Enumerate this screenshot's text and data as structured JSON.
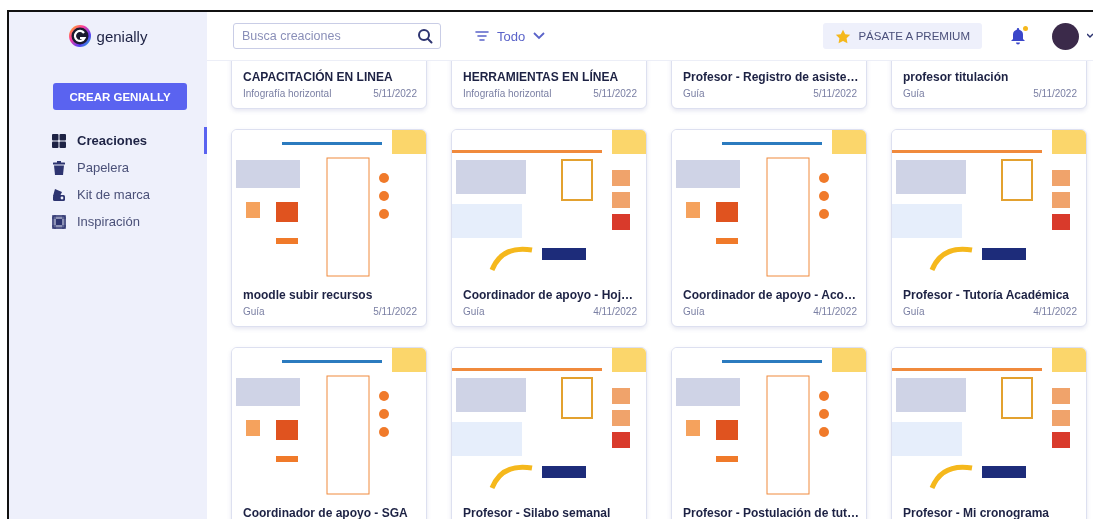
{
  "brand": {
    "name": "genially"
  },
  "create_button": "CREAR GENIALLY",
  "sidebar": {
    "items": [
      {
        "label": "Creaciones",
        "selected": true
      },
      {
        "label": "Papelera",
        "selected": false
      },
      {
        "label": "Kit de marca",
        "selected": false
      },
      {
        "label": "Inspiración",
        "selected": false
      }
    ]
  },
  "header": {
    "search": {
      "placeholder": "Busca creaciones"
    },
    "filter": {
      "label": "Todo"
    },
    "premium_button": "PÁSATE A PREMIUM",
    "notifications": {
      "unread": true
    }
  },
  "creations": [
    {
      "title": "CAPACITACIÓN EN LINEA",
      "type": "Infografía horizontal",
      "date": "5/11/2022"
    },
    {
      "title": "HERRAMIENTAS EN LÍNEA",
      "type": "Infografía horizontal",
      "date": "5/11/2022"
    },
    {
      "title": "Profesor - Registro de asiste…",
      "type": "Guía",
      "date": "5/11/2022"
    },
    {
      "title": "profesor titulación",
      "type": "Guía",
      "date": "5/11/2022"
    },
    {
      "title": "moodle subir recursos",
      "type": "Guía",
      "date": "5/11/2022"
    },
    {
      "title": "Coordinador  de apoyo - Hoj…",
      "type": "Guía",
      "date": "4/11/2022"
    },
    {
      "title": "Coordinador  de apoyo - Aco…",
      "type": "Guía",
      "date": "4/11/2022"
    },
    {
      "title": "Profesor - Tutoría Académica",
      "type": "Guía",
      "date": "4/11/2022"
    },
    {
      "title": "Coordinador  de apoyo - SGA"
    },
    {
      "title": "Profesor - Silabo semanal"
    },
    {
      "title": "Profesor - Postulación de tut…"
    },
    {
      "title": "Profesor - Mi cronograma"
    }
  ]
}
